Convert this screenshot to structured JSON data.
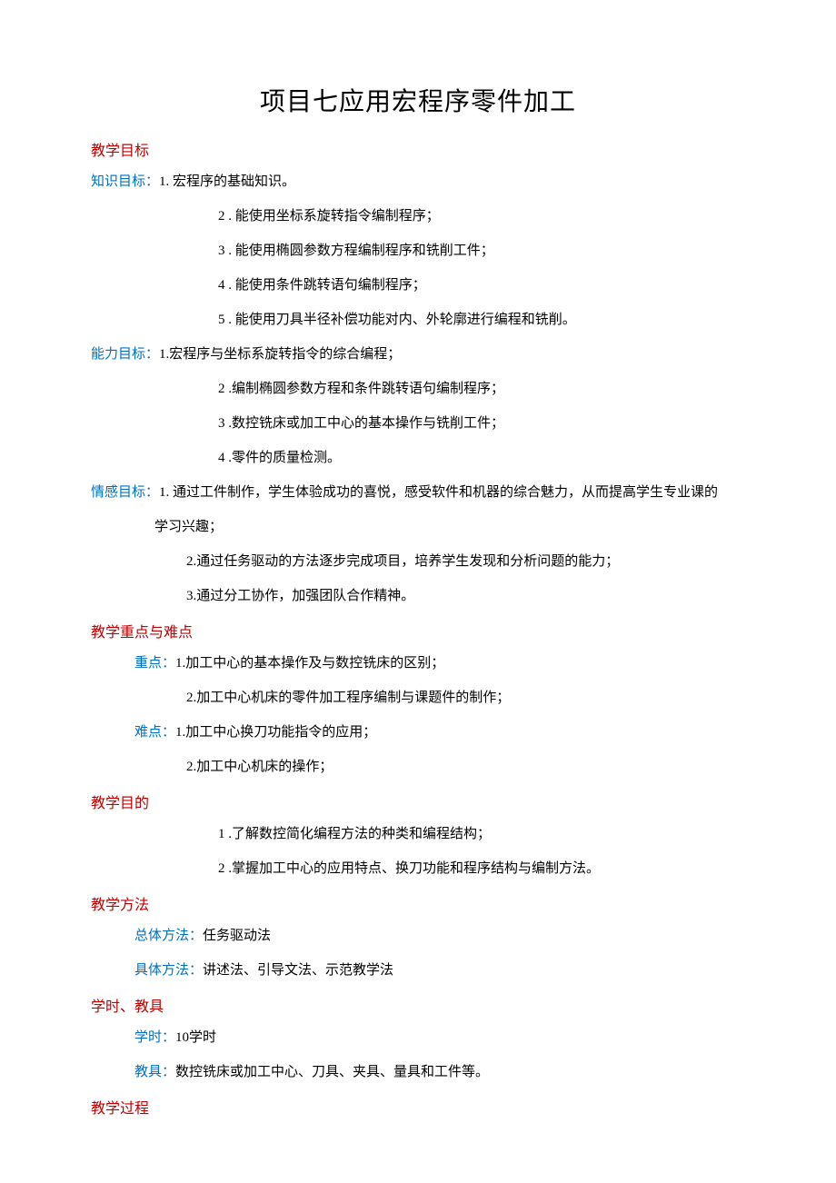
{
  "title": "项目七应用宏程序零件加工",
  "sections": {
    "goals": {
      "heading": "教学目标",
      "knowledge": {
        "label": "知识目标：",
        "items": [
          "1. 宏程序的基础知识。",
          "2 . 能使用坐标系旋转指令编制程序；",
          "3 . 能使用椭圆参数方程编制程序和铣削工件；",
          "4 . 能使用条件跳转语句编制程序；",
          "5 . 能使用刀具半径补偿功能对内、外轮廓进行编程和铣削。"
        ]
      },
      "ability": {
        "label": "能力目标：",
        "items": [
          "1.宏程序与坐标系旋转指令的综合编程；",
          "2 .编制椭圆参数方程和条件跳转语句编制程序；",
          "3 .数控铣床或加工中心的基本操作与铣削工件；",
          "4 .零件的质量检测。"
        ]
      },
      "emotion": {
        "label": "情感目标：",
        "items_line1a": "1. 通过工件制作，学生体验成功的喜悦，感受软件和机器的综合魅力，从而提高学生专业课的",
        "items_line1b": "学习兴趣；",
        "items": [
          "2.通过任务驱动的方法逐步完成项目，培养学生发现和分析问题的能力；",
          "3.通过分工协作，加强团队合作精神。"
        ]
      }
    },
    "keypoints": {
      "heading": "教学重点与难点",
      "keypoint": {
        "label": "重点：",
        "items": [
          "1.加工中心的基本操作及与数控铣床的区别；",
          "2.加工中心机床的零件加工程序编制与课题件的制作；"
        ]
      },
      "difficulty": {
        "label": "难点：",
        "items": [
          "1.加工中心换刀功能指令的应用；",
          "2.加工中心机床的操作；"
        ]
      }
    },
    "purpose": {
      "heading": "教学目的",
      "items": [
        "1 .了解数控简化编程方法的种类和编程结构；",
        "2 .掌握加工中心的应用特点、换刀功能和程序结构与编制方法。"
      ]
    },
    "methods": {
      "heading": "教学方法",
      "overall": {
        "label": "总体方法：",
        "text": "任务驱动法"
      },
      "specific": {
        "label": "具体方法：",
        "text": "讲述法、引导文法、示范教学法"
      }
    },
    "hours": {
      "heading": "学时、教具",
      "hours": {
        "label": "学时：",
        "text": "10学时"
      },
      "tools": {
        "label": "教具：",
        "text": "数控铣床或加工中心、刀具、夹具、量具和工件等。"
      }
    },
    "process": {
      "heading": "教学过程"
    }
  }
}
